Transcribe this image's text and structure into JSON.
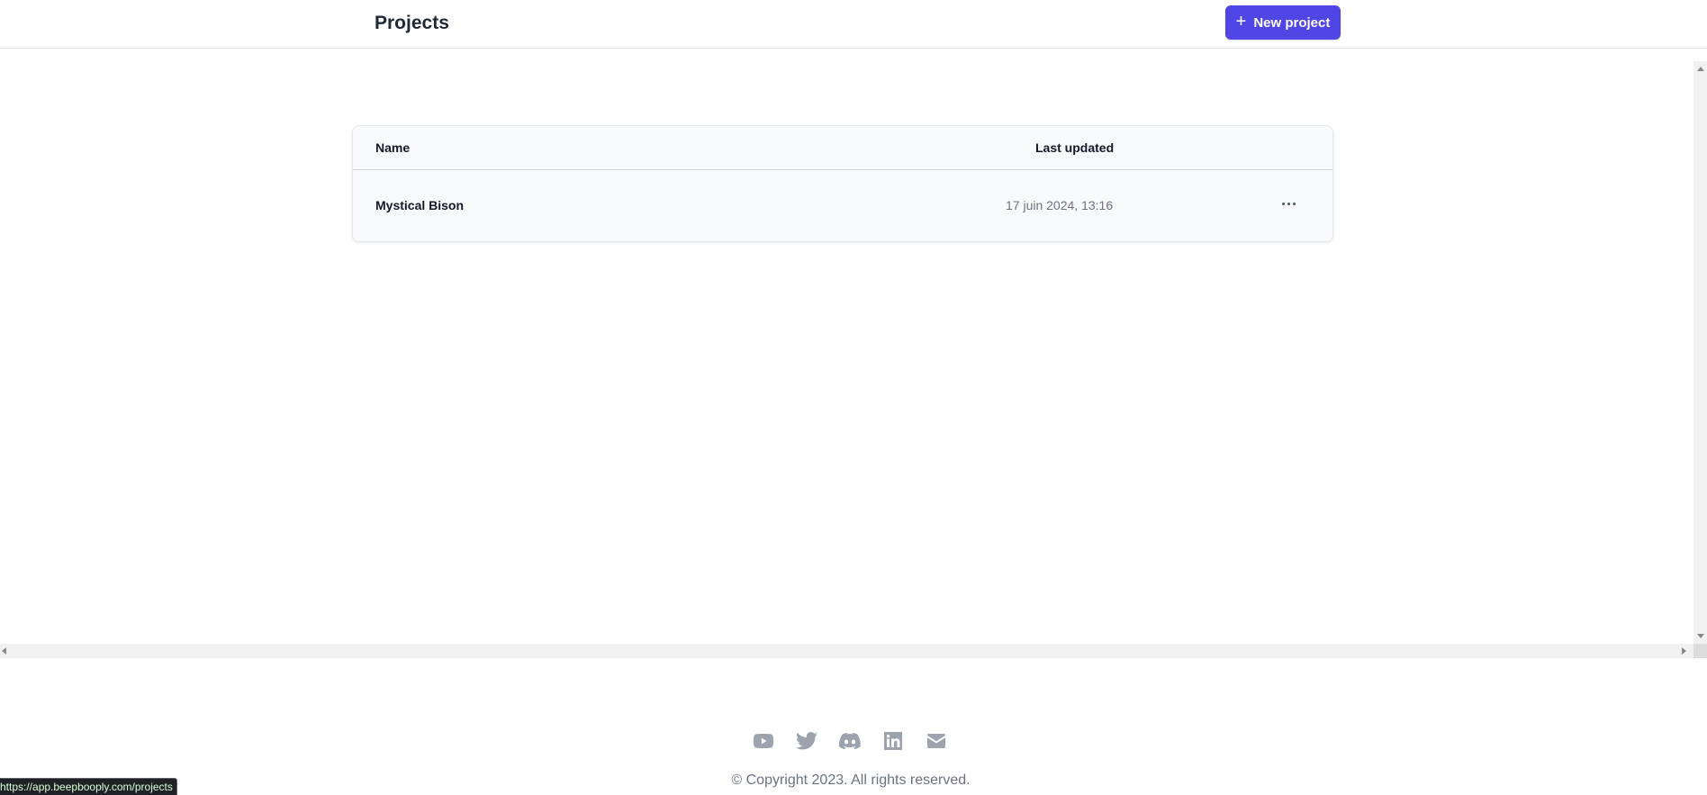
{
  "header": {
    "title": "Projects",
    "new_button": {
      "icon": "plus-icon",
      "label": "New project",
      "color": "#4f46e5"
    }
  },
  "table": {
    "columns": [
      "Name",
      "Last updated"
    ],
    "rows": [
      {
        "name": "Mystical Bison",
        "last_updated": "17 juin 2024, 13:16",
        "menu_icon": "ellipsis-icon"
      }
    ]
  },
  "footer": {
    "icons": [
      "youtube-icon",
      "twitter-icon",
      "discord-icon",
      "linkedin-icon",
      "mail-icon"
    ],
    "copyright": "© Copyright 2023. All rights reserved."
  },
  "status_bar": {
    "url": "https://app.beepbooply.com/projects"
  }
}
